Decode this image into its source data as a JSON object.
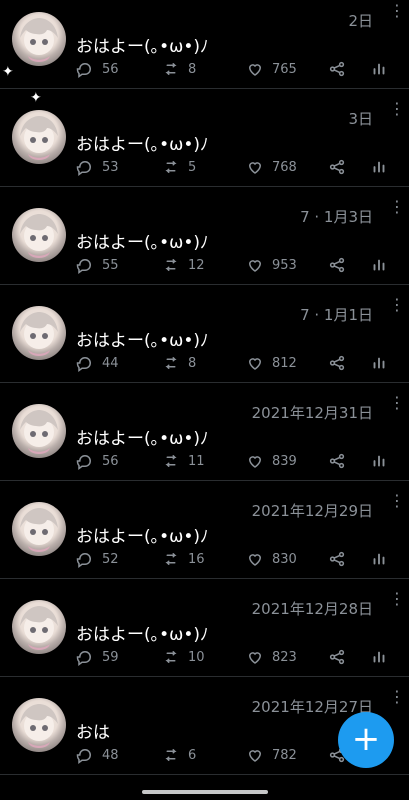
{
  "tweets": [
    {
      "name": "",
      "date": "2日",
      "text": "おはよー(｡•ω•)ﾉ",
      "replies": "56",
      "retweets": "8",
      "likes": "765"
    },
    {
      "name": "",
      "date": "3日",
      "text": "おはよー(｡•ω•)ﾉ",
      "replies": "53",
      "retweets": "5",
      "likes": "768"
    },
    {
      "name": "",
      "date": "7 · 1月3日",
      "text": "おはよー(｡•ω•)ﾉ",
      "replies": "55",
      "retweets": "12",
      "likes": "953"
    },
    {
      "name": "",
      "date": "7 · 1月1日",
      "text": "おはよー(｡•ω•)ﾉ",
      "replies": "44",
      "retweets": "8",
      "likes": "812"
    },
    {
      "name": "",
      "date": "2021年12月31日",
      "text": "おはよー(｡•ω•)ﾉ",
      "replies": "56",
      "retweets": "11",
      "likes": "839"
    },
    {
      "name": "",
      "date": "2021年12月29日",
      "text": "おはよー(｡•ω•)ﾉ",
      "replies": "52",
      "retweets": "16",
      "likes": "830"
    },
    {
      "name": "",
      "date": "2021年12月28日",
      "text": "おはよー(｡•ω•)ﾉ",
      "replies": "59",
      "retweets": "10",
      "likes": "823"
    },
    {
      "name": "",
      "date": "2021年12月27日",
      "text": "おは",
      "replies": "48",
      "retweets": "6",
      "likes": "782"
    }
  ],
  "fab": {
    "label": "+"
  },
  "colors": {
    "accent": "#1d9bf0",
    "bg": "#000000",
    "muted": "#8b9198"
  }
}
